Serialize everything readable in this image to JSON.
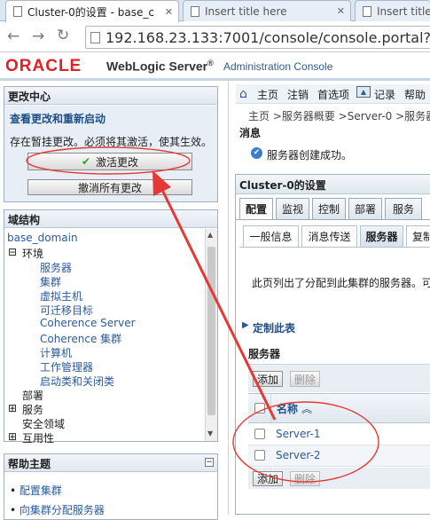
{
  "browser": {
    "tabs": [
      {
        "title": "Cluster-0的设置 - base_c"
      },
      {
        "title": "Insert title here"
      },
      {
        "title": "Insert title"
      }
    ],
    "url": "192.168.23.133:7001/console/console.portal?_nf"
  },
  "header": {
    "oracle": "ORACLE",
    "product": "WebLogic Server",
    "reg": "®",
    "console": "Administration Console"
  },
  "toolbar": {
    "home": "主页",
    "logout": "注销",
    "prefs": "首选项",
    "record": "记录",
    "help": "帮助"
  },
  "breadcrumb": "主页 >服务器概要 >Server-0 >服务器",
  "change_center": {
    "title": "更改中心",
    "subtitle": "查看更改和重新启动",
    "message": "存在暂挂更改。必须将其激活，使其生效。",
    "activate_label": "激活更改",
    "undo_label": "撤消所有更改"
  },
  "domain_structure": {
    "title": "域结构",
    "root": "base_domain",
    "items": [
      {
        "label": "环境",
        "toggle": "⊟"
      },
      {
        "label": "服务器"
      },
      {
        "label": "集群"
      },
      {
        "label": "虚拟主机"
      },
      {
        "label": "可迁移目标"
      },
      {
        "label": "Coherence Server"
      },
      {
        "label": "Coherence 集群"
      },
      {
        "label": "计算机"
      },
      {
        "label": "工作管理器"
      },
      {
        "label": "启动类和关闭类"
      },
      {
        "label": "部署"
      },
      {
        "label": "服务",
        "toggle": "⊞"
      },
      {
        "label": "安全领域"
      },
      {
        "label": "互用性",
        "toggle": "⊞"
      }
    ]
  },
  "help_topics": {
    "title": "帮助主题",
    "items": [
      "配置集群",
      "向集群分配服务器"
    ]
  },
  "messages": {
    "title": "消息",
    "success": "服务器创建成功。"
  },
  "settings": {
    "title": "Cluster-0的设置",
    "tabs": [
      "配置",
      "监视",
      "控制",
      "部署",
      "服务"
    ],
    "subtabs": [
      "一般信息",
      "消息传送",
      "服务器",
      "复制"
    ],
    "description": "此页列出了分配到此集群的服务器。可",
    "customize": "定制此表",
    "table_title": "服务器",
    "add_label": "添加",
    "delete_label": "删除",
    "col_name": "名称",
    "sort_icon": "︽",
    "rows": [
      "Server-1",
      "Server-2"
    ]
  },
  "colors": {
    "annotation": "#e53935",
    "link": "#2a5b9e"
  }
}
